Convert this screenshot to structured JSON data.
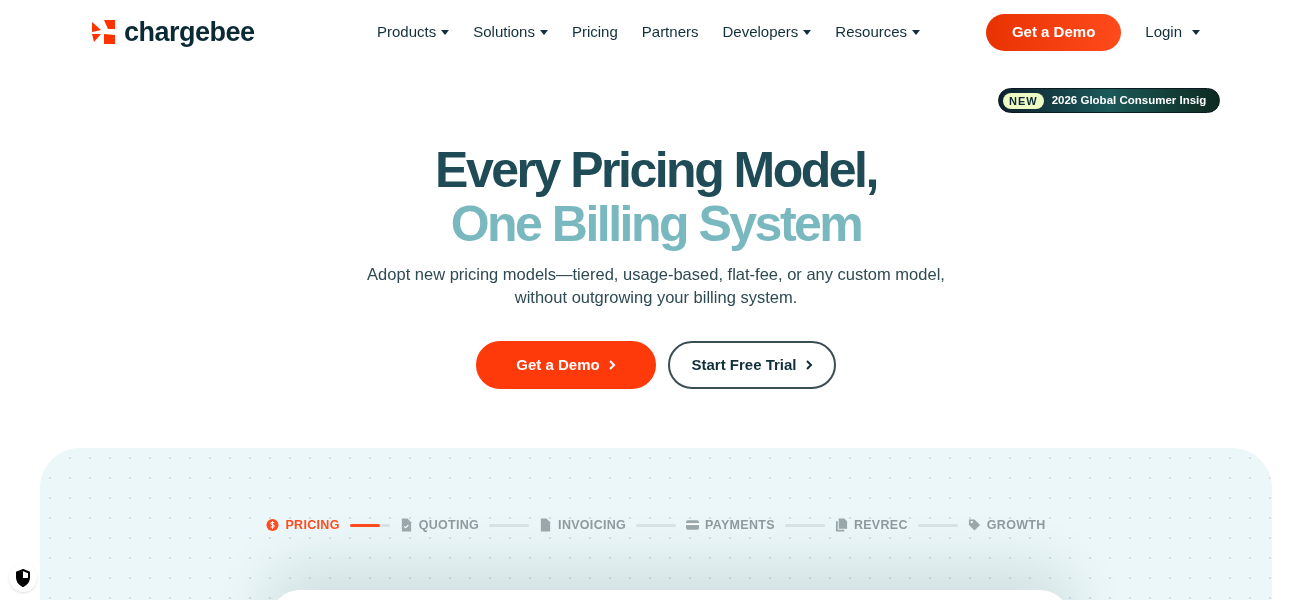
{
  "brand": {
    "name": "chargebee"
  },
  "nav": [
    {
      "label": "Products",
      "dropdown": true
    },
    {
      "label": "Solutions",
      "dropdown": true
    },
    {
      "label": "Pricing",
      "dropdown": false
    },
    {
      "label": "Partners",
      "dropdown": false
    },
    {
      "label": "Developers",
      "dropdown": true
    },
    {
      "label": "Resources",
      "dropdown": true
    }
  ],
  "header_button": "Get a Demo",
  "login": {
    "label": "Login",
    "dropdown": true
  },
  "announcement": {
    "badge": "NEW",
    "text": "2026 Global Consumer Insig"
  },
  "hero": {
    "title_line_1": "Every Pricing Model,",
    "title_line_2": "One Billing System",
    "subtitle": "Adopt new pricing models—tiered, usage-based, flat-fee, or any custom model, without outgrowing your billing system."
  },
  "buttons": [
    {
      "label": "Get a Demo",
      "kind": "primary"
    },
    {
      "label": "Start Free Trial",
      "kind": "outline"
    }
  ],
  "steps": [
    {
      "label": "PRICING",
      "selected": true,
      "level": 0.75
    },
    {
      "label": "QUOTING",
      "selected": false,
      "level": 0
    },
    {
      "label": "INVOICING",
      "selected": false,
      "level": 0
    },
    {
      "label": "PAYMENTS",
      "selected": false,
      "level": 0
    },
    {
      "label": "REVREC",
      "selected": false,
      "level": 0
    },
    {
      "label": "GROWTH",
      "selected": false
    }
  ]
}
